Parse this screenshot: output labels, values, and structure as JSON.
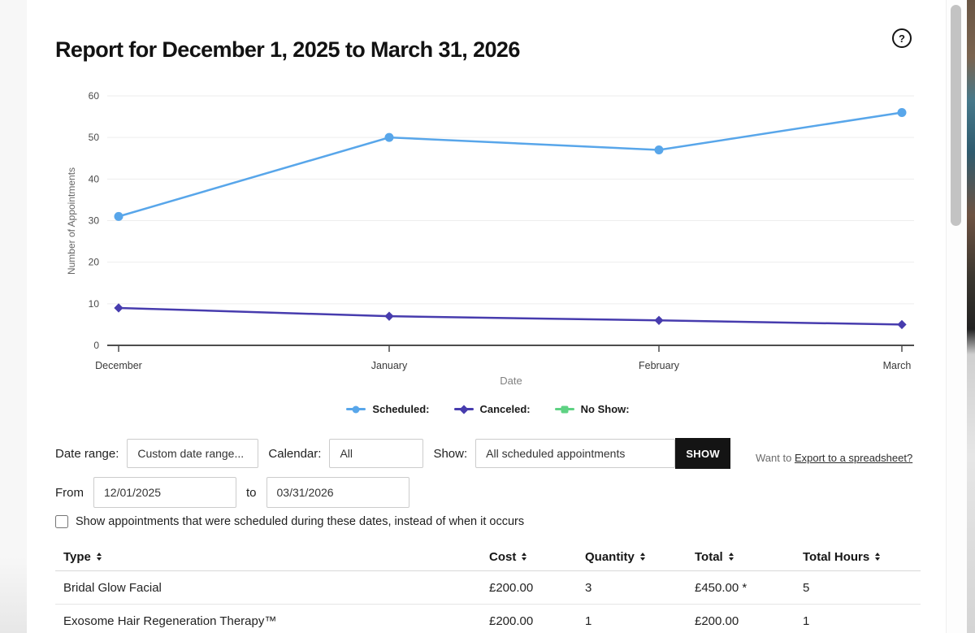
{
  "header": {
    "title": "Report for December 1, 2025 to March 31, 2026",
    "help_glyph": "?"
  },
  "chart_data": {
    "type": "line",
    "x": [
      "December",
      "January",
      "February",
      "March"
    ],
    "series": [
      {
        "name": "Scheduled:",
        "color": "#58a6ea",
        "marker": "circle",
        "values": [
          31,
          50,
          47,
          56
        ]
      },
      {
        "name": "Canceled:",
        "color": "#473cae",
        "marker": "diamond",
        "values": [
          9,
          7,
          6,
          5
        ]
      },
      {
        "name": "No Show:",
        "color": "#5ed283",
        "marker": "plus",
        "values": []
      }
    ],
    "xlabel": "Date",
    "ylabel": "Number of Appointments",
    "ylim": [
      0,
      60
    ],
    "yticks": [
      0,
      10,
      20,
      30,
      40,
      50,
      60
    ],
    "grid": true,
    "legend_position": "bottom"
  },
  "filters": {
    "date_range_label": "Date range:",
    "date_range_value": "Custom date range...",
    "calendar_label": "Calendar:",
    "calendar_value": "All",
    "show_label": "Show:",
    "show_value": "All scheduled appointments",
    "show_button": "SHOW",
    "export_prefix": "Want to ",
    "export_link": "Export to a spreadsheet?"
  },
  "range_row": {
    "from_label": "From",
    "from_value": "12/01/2025",
    "to_label": "to",
    "to_value": "03/31/2026"
  },
  "checkbox": {
    "label": "Show appointments that were scheduled during these dates, instead of when it occurs",
    "checked": false
  },
  "table": {
    "headers": [
      "Type",
      "Cost",
      "Quantity",
      "Total",
      "Total Hours"
    ],
    "rows": [
      [
        "Bridal Glow Facial",
        "£200.00",
        "3",
        "£450.00 *",
        "5"
      ],
      [
        "Exosome Hair Regeneration Therapy™",
        "£200.00",
        "1",
        "£200.00",
        "1"
      ]
    ]
  }
}
